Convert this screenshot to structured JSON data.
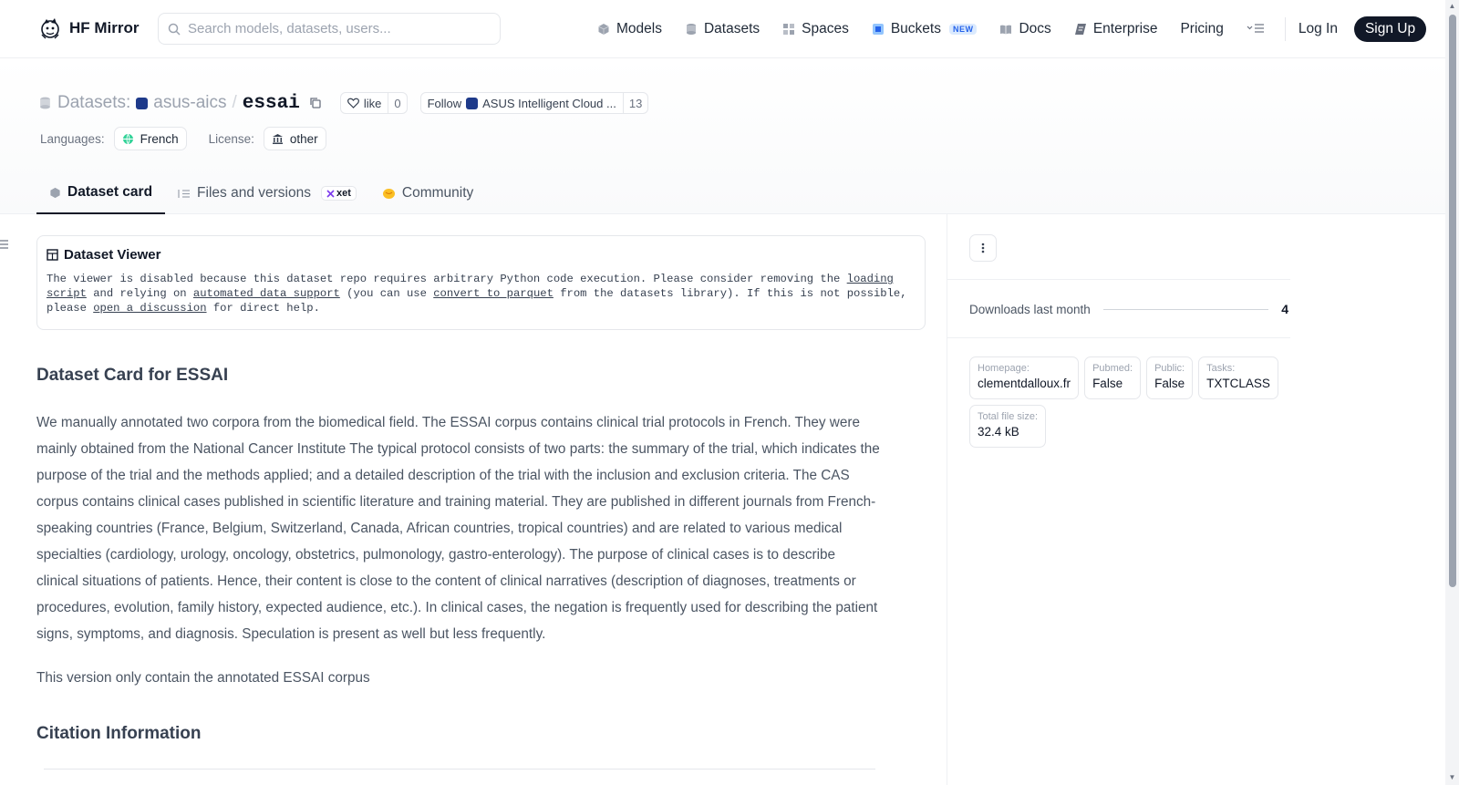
{
  "header": {
    "brand": "HF Mirror",
    "search_placeholder": "Search models, datasets, users...",
    "nav": {
      "models": "Models",
      "datasets": "Datasets",
      "spaces": "Spaces",
      "buckets": "Buckets",
      "buckets_badge": "NEW",
      "docs": "Docs",
      "enterprise": "Enterprise",
      "pricing": "Pricing"
    },
    "login": "Log In",
    "signup": "Sign Up"
  },
  "repo": {
    "type_label": "Datasets:",
    "org": "asus-aics",
    "separator": "/",
    "name": "essai",
    "like_label": "like",
    "like_count": "0",
    "follow_label": "Follow",
    "follow_org": "ASUS Intelligent Cloud ...",
    "follow_count": "13",
    "languages_label": "Languages:",
    "language": "French",
    "license_label": "License:",
    "license": "other"
  },
  "tabs": {
    "dataset_card": "Dataset card",
    "files": "Files and versions",
    "xet": "xet",
    "community": "Community"
  },
  "viewer": {
    "title": "Dataset Viewer",
    "t1": "The viewer is disabled because this dataset repo requires arbitrary Python code execution. Please consider removing the ",
    "link_loading_script": "loading script",
    "t2": " and relying on ",
    "link_auto": "automated data support",
    "t3": " (you can use ",
    "link_convert": "convert to parquet",
    "t4": " from the datasets library). If this is not possible, please ",
    "link_discussion": "open a discussion",
    "t5": " for direct help."
  },
  "card": {
    "heading": "Dataset Card for ESSAI",
    "description": "We manually annotated two corpora from the biomedical field. The ESSAI corpus contains clinical trial protocols in French. They were mainly obtained from the National Cancer Institute The typical protocol consists of two parts: the summary of the trial, which indicates the purpose of the trial and the methods applied; and a detailed description of the trial with the inclusion and exclusion criteria. The CAS corpus contains clinical cases published in scientific literature and training material. They are published in different journals from French-speaking countries (France, Belgium, Switzerland, Canada, African countries, tropical countries) and are related to various medical specialties (cardiology, urology, oncology, obstetrics, pulmonology, gastro-enterology). The purpose of clinical cases is to describe clinical situations of patients. Hence, their content is close to the content of clinical narratives (description of diagnoses, treatments or procedures, evolution, family history, expected audience, etc.). In clinical cases, the negation is frequently used for describing the patient signs, symptoms, and diagnosis. Speculation is present as well but less frequently.",
    "version_note": "This version only contain the annotated ESSAI corpus",
    "citation_heading": "Citation Information"
  },
  "sidebar": {
    "downloads_label": "Downloads last month",
    "downloads_value": "4",
    "meta": [
      {
        "key": "Homepage:",
        "value": "clementdalloux.fr"
      },
      {
        "key": "Pubmed:",
        "value": "False"
      },
      {
        "key": "Public:",
        "value": "False"
      },
      {
        "key": "Tasks:",
        "value": "TXTCLASS"
      },
      {
        "key": "Total file size:",
        "value": "32.4 kB"
      }
    ]
  },
  "colors": {
    "accent_dark": "#111827",
    "muted": "#9ca3af",
    "new_badge": "#2563eb"
  }
}
